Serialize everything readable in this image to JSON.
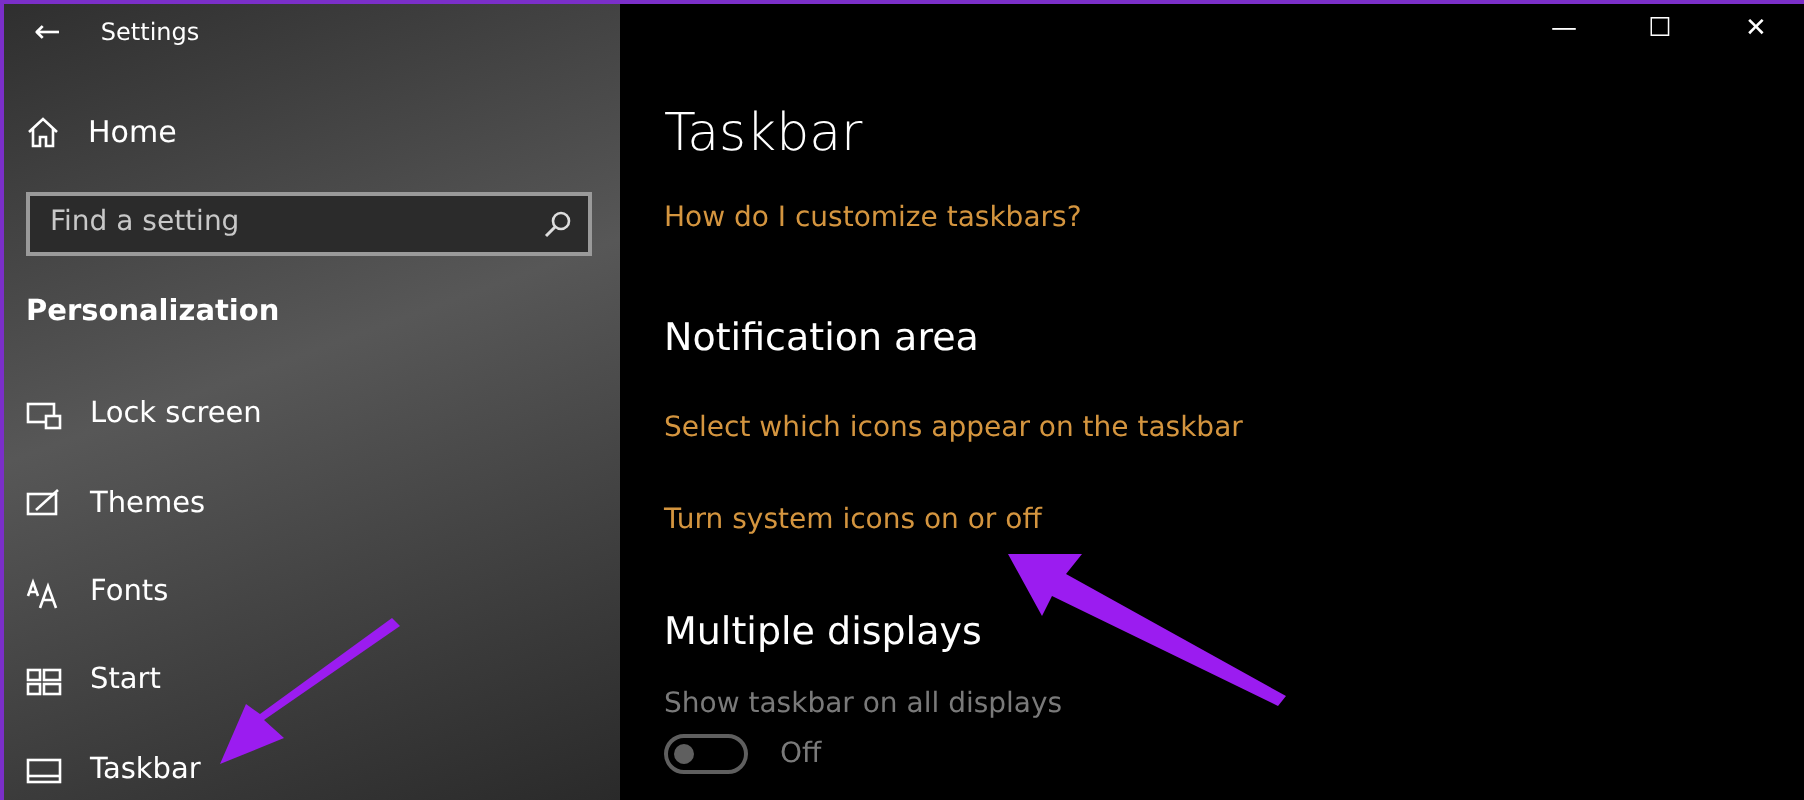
{
  "window": {
    "title": "Settings",
    "back": "←",
    "controls": [
      "—",
      "☐",
      "✕"
    ]
  },
  "sidebar": {
    "home": "Home",
    "search": {
      "placeholder": "Find a setting"
    },
    "section": "Personalization",
    "items": [
      {
        "label": "Lock screen",
        "kind": "lock"
      },
      {
        "label": "Themes",
        "kind": "themes"
      },
      {
        "label": "Fonts",
        "kind": "fonts"
      },
      {
        "label": "Start",
        "kind": "start"
      },
      {
        "label": "Taskbar",
        "kind": "taskbar"
      }
    ]
  },
  "content": {
    "title": "Taskbar",
    "help_link": "How do I customize taskbars?",
    "sections": [
      {
        "heading": "Notification area",
        "links": [
          "Select which icons appear on the taskbar",
          "Turn system icons on or off"
        ]
      },
      {
        "heading": "Multiple displays",
        "setting": {
          "label": "Show taskbar on all displays",
          "on": false,
          "disabled": true,
          "state_text": "Off"
        }
      }
    ]
  }
}
